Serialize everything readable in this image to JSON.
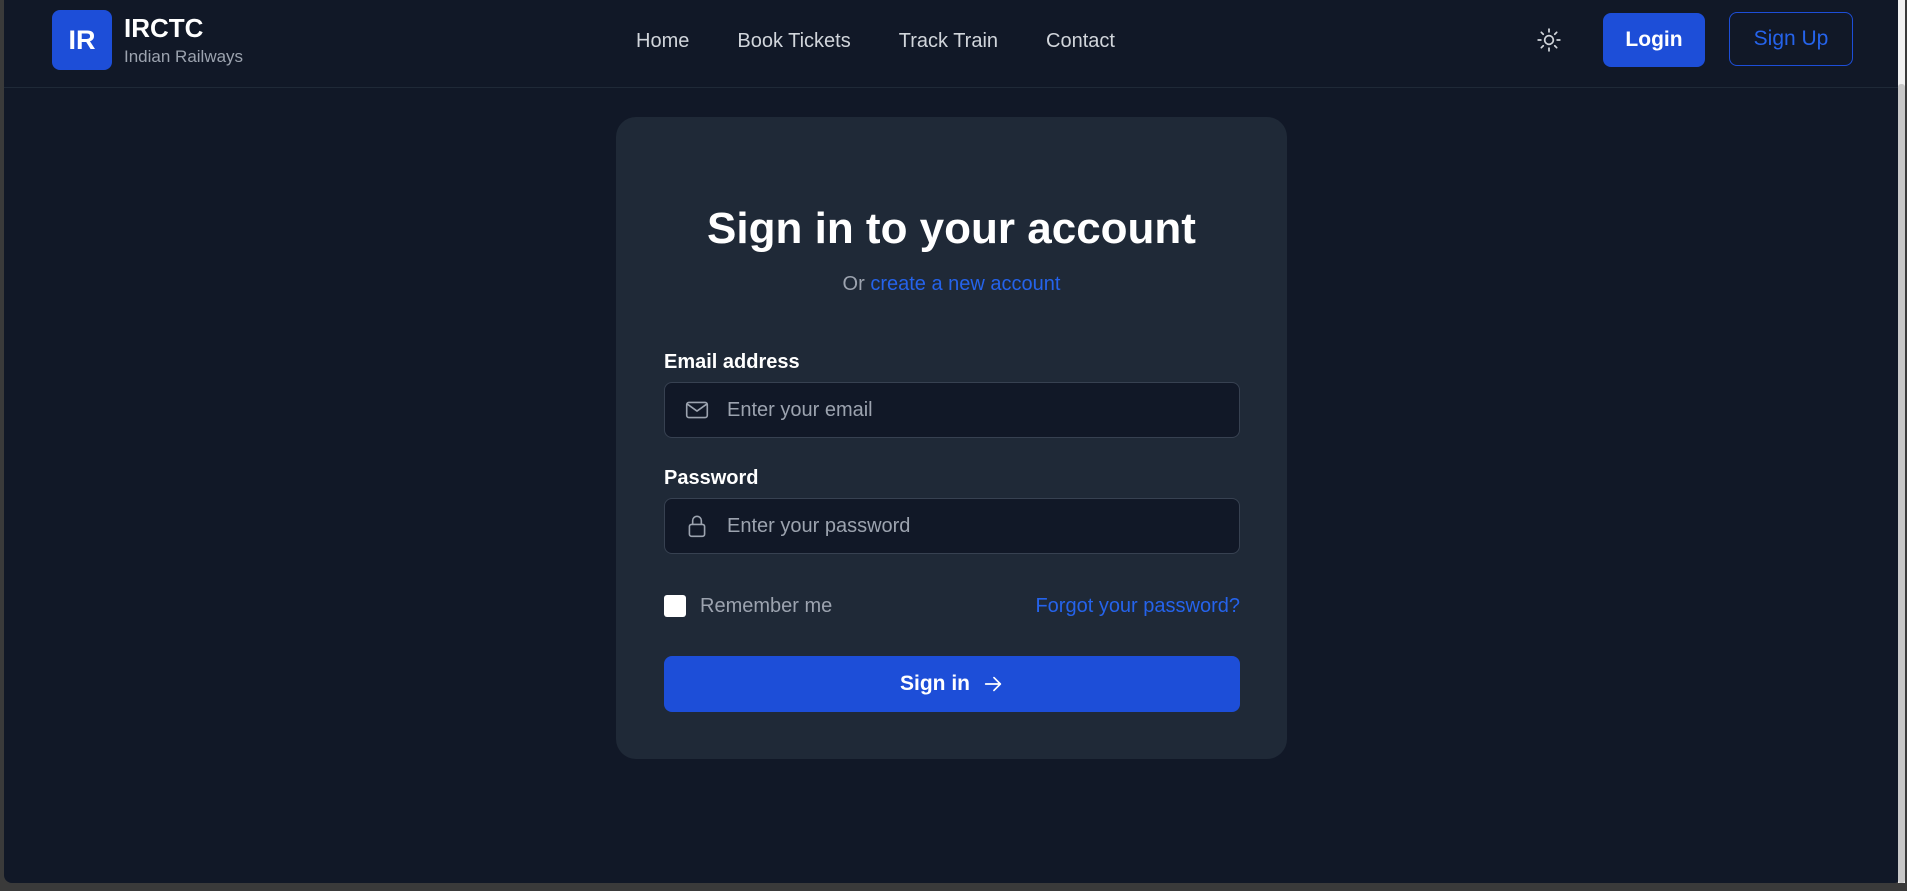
{
  "brand": {
    "logo_text": "IR",
    "name": "IRCTC",
    "subtitle": "Indian Railways"
  },
  "nav": {
    "links": [
      "Home",
      "Book Tickets",
      "Track Train",
      "Contact"
    ]
  },
  "header_actions": {
    "theme_icon": "sun-icon",
    "login_label": "Login",
    "signup_label": "Sign Up"
  },
  "signin": {
    "title": "Sign in to your account",
    "subtitle_prefix": "Or",
    "create_account_link": "create a new account",
    "email": {
      "label": "Email address",
      "placeholder": "Enter your email",
      "value": "",
      "icon": "mail-icon"
    },
    "password": {
      "label": "Password",
      "placeholder": "Enter your password",
      "value": "",
      "icon": "lock-icon"
    },
    "remember_label": "Remember me",
    "remember_checked": false,
    "forgot_link": "Forgot your password?",
    "submit_label": "Sign in",
    "submit_icon": "arrow-right-icon"
  },
  "colors": {
    "background": "#111827",
    "card": "#1f2937",
    "accent": "#1d4ed8",
    "link": "#2563eb"
  }
}
